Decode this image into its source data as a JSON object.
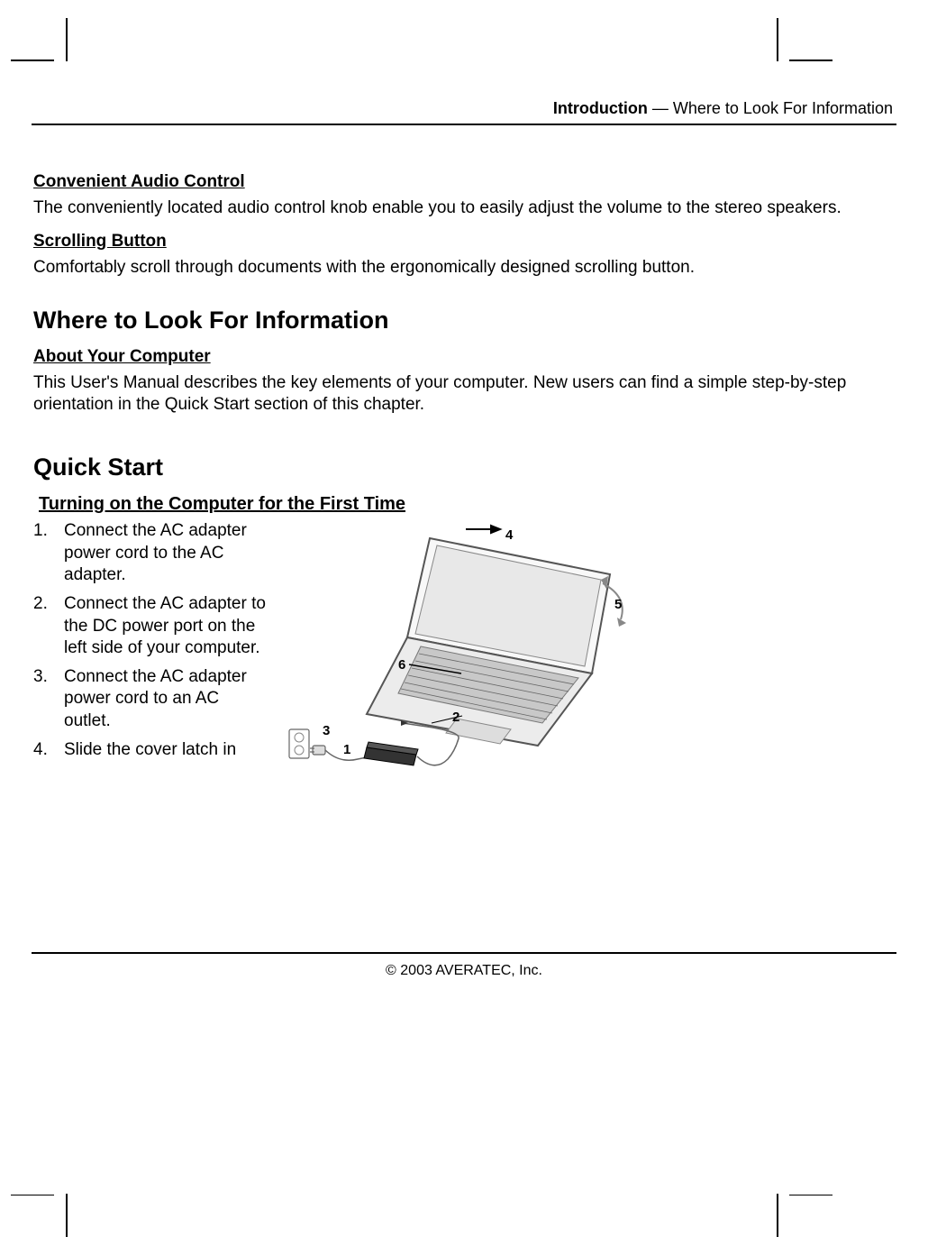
{
  "header": {
    "section": "Introduction",
    "separator": " — ",
    "subsection": "Where to Look For Information"
  },
  "sections": {
    "audio": {
      "heading": "Convenient Audio Control",
      "text": "The conveniently located audio control knob enable you to easily adjust the volume to the stereo speakers."
    },
    "scroll": {
      "heading": "Scrolling Button",
      "text": "Comfortably scroll through documents with the ergonomically designed scrolling button."
    },
    "where": {
      "heading": "Where to Look For Information",
      "sub": "About Your Computer",
      "text": "This User's Manual describes the key elements of your computer. New users can find a simple step-by-step orientation in the Quick Start section of this chapter."
    },
    "quick": {
      "heading": "Quick Start",
      "sub": "Turning on the Computer for the First Time",
      "steps": [
        "Connect the AC adapter power cord to the AC adapter.",
        "Connect the AC adapter to the DC power port on the left side of your computer.",
        "Connect the AC adapter power cord to an AC outlet.",
        "Slide the cover latch in"
      ],
      "callouts": {
        "c1": "1",
        "c2": "2",
        "c3": "3",
        "c4": "4",
        "c5": "5",
        "c6": "6"
      }
    }
  },
  "footer": "© 2003 AVERATEC, Inc."
}
